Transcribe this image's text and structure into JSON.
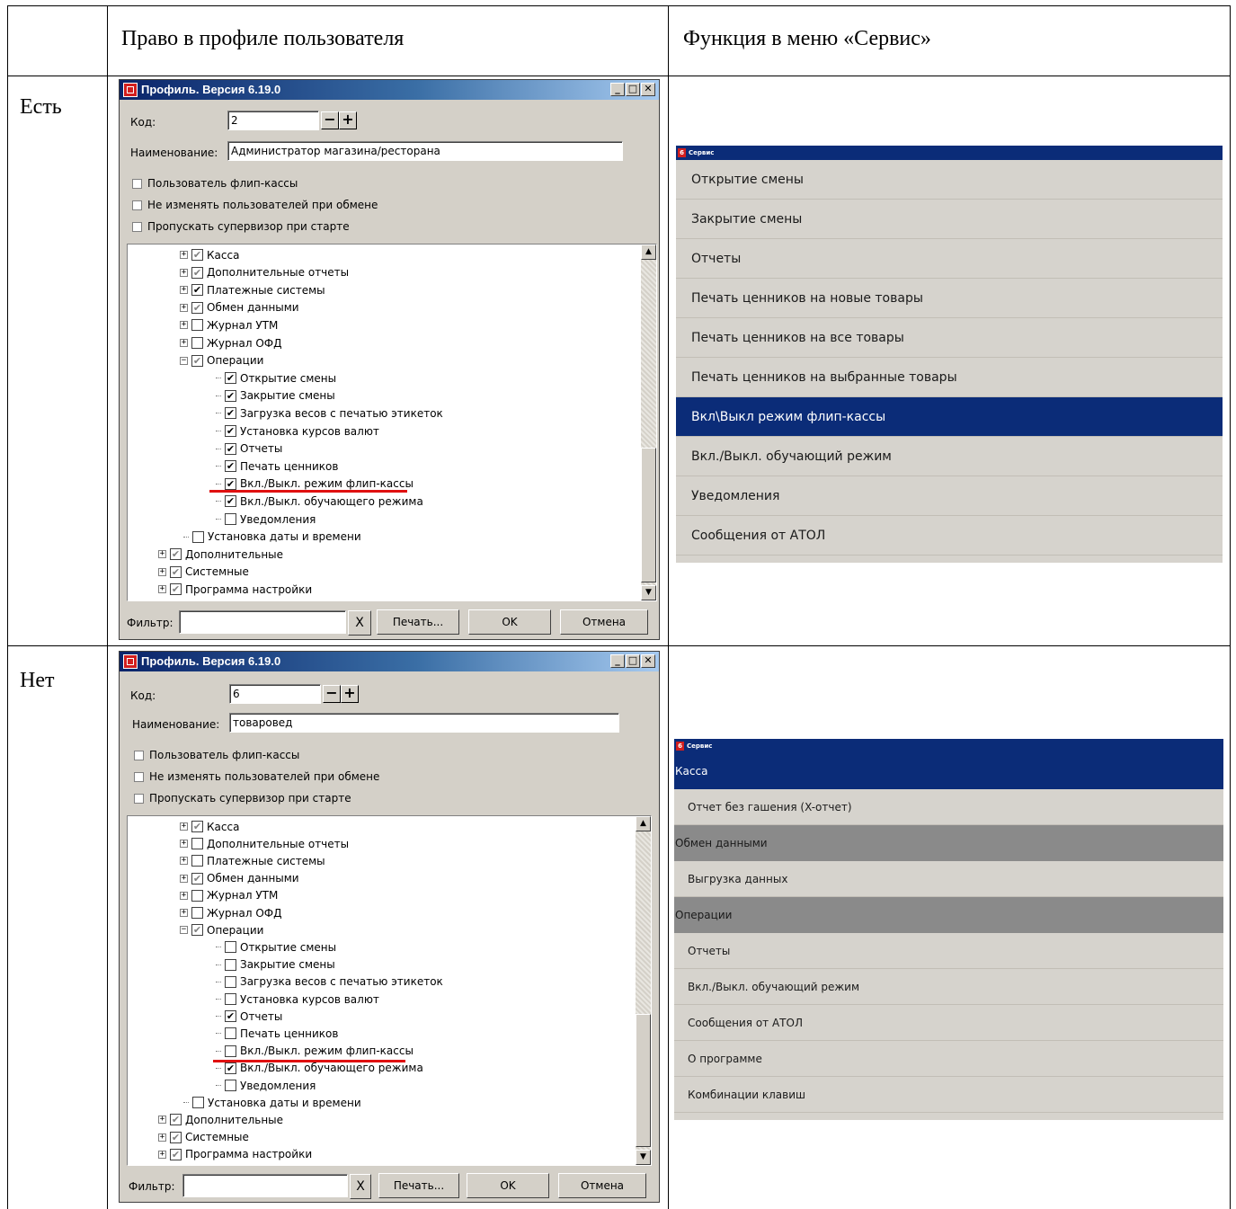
{
  "table": {
    "col1_header": "Право в профиле пользователя",
    "col2_header": "Функция в меню «Сервис»",
    "row1_label": "Есть",
    "row2_label": "Нет"
  },
  "dialog1": {
    "title": "Профиль. Версия 6.19.0",
    "code_label": "Код:",
    "code_value": "2",
    "name_label": "Наименование:",
    "name_value": "Администратор магазина/ресторана",
    "opt1": "Пользователь флип-кассы",
    "opt2": "Не изменять пользователей при обмене",
    "opt3": "Пропускать супервизор при старте",
    "tree": [
      {
        "label": "Касса",
        "check": "grey",
        "exp": "+",
        "lvl": 1
      },
      {
        "label": "Дополнительные отчеты",
        "check": "grey",
        "exp": "+",
        "lvl": 1
      },
      {
        "label": "Платежные системы",
        "check": "on",
        "exp": "+",
        "lvl": 1
      },
      {
        "label": "Обмен данными",
        "check": "grey",
        "exp": "+",
        "lvl": 1
      },
      {
        "label": "Журнал УТМ",
        "check": "off",
        "exp": "+",
        "lvl": 1
      },
      {
        "label": "Журнал ОФД",
        "check": "off",
        "exp": "+",
        "lvl": 1
      },
      {
        "label": "Операции",
        "check": "grey",
        "exp": "-",
        "lvl": 1
      },
      {
        "label": "Открытие смены",
        "check": "on",
        "exp": "",
        "lvl": 2
      },
      {
        "label": "Закрытие смены",
        "check": "on",
        "exp": "",
        "lvl": 2
      },
      {
        "label": "Загрузка весов с печатью этикеток",
        "check": "on",
        "exp": "",
        "lvl": 2
      },
      {
        "label": "Установка курсов валют",
        "check": "on",
        "exp": "",
        "lvl": 2
      },
      {
        "label": "Отчеты",
        "check": "on",
        "exp": "",
        "lvl": 2
      },
      {
        "label": "Печать ценников",
        "check": "on",
        "exp": "",
        "lvl": 2
      },
      {
        "label": "Вкл./Выкл. режим флип-кассы",
        "check": "on",
        "exp": "",
        "lvl": 2
      },
      {
        "label": "Вкл./Выкл. обучающего режима",
        "check": "on",
        "exp": "",
        "lvl": 2
      },
      {
        "label": "Уведомления",
        "check": "off",
        "exp": "",
        "lvl": 2
      },
      {
        "label": "Установка даты и времени",
        "check": "off",
        "exp": "",
        "lvl": 1.5
      },
      {
        "label": "Дополнительные",
        "check": "grey",
        "exp": "+",
        "lvl": 0
      },
      {
        "label": "Системные",
        "check": "grey",
        "exp": "+",
        "lvl": 0
      },
      {
        "label": "Программа настройки",
        "check": "grey",
        "exp": "+",
        "lvl": 0
      }
    ],
    "filter_label": "Фильтр:",
    "filter_value": "",
    "clear_glyph": "X",
    "print_btn": "Печать...",
    "ok_btn": "OK",
    "cancel_btn": "Отмена"
  },
  "dialog2": {
    "title": "Профиль. Версия 6.19.0",
    "code_label": "Код:",
    "code_value": "6",
    "name_label": "Наименование:",
    "name_value": "товаровед",
    "opt1": "Пользователь флип-кассы",
    "opt2": "Не изменять пользователей при обмене",
    "opt3": "Пропускать супервизор при старте",
    "tree": [
      {
        "label": "Касса",
        "check": "grey",
        "exp": "+",
        "lvl": 1
      },
      {
        "label": "Дополнительные отчеты",
        "check": "off",
        "exp": "+",
        "lvl": 1
      },
      {
        "label": "Платежные системы",
        "check": "off",
        "exp": "+",
        "lvl": 1
      },
      {
        "label": "Обмен данными",
        "check": "grey",
        "exp": "+",
        "lvl": 1
      },
      {
        "label": "Журнал УТМ",
        "check": "off",
        "exp": "+",
        "lvl": 1
      },
      {
        "label": "Журнал ОФД",
        "check": "off",
        "exp": "+",
        "lvl": 1
      },
      {
        "label": "Операции",
        "check": "grey",
        "exp": "-",
        "lvl": 1
      },
      {
        "label": "Открытие смены",
        "check": "off",
        "exp": "",
        "lvl": 2
      },
      {
        "label": "Закрытие смены",
        "check": "off",
        "exp": "",
        "lvl": 2
      },
      {
        "label": "Загрузка весов с печатью этикеток",
        "check": "off",
        "exp": "",
        "lvl": 2
      },
      {
        "label": "Установка курсов валют",
        "check": "off",
        "exp": "",
        "lvl": 2
      },
      {
        "label": "Отчеты",
        "check": "on",
        "exp": "",
        "lvl": 2
      },
      {
        "label": "Печать ценников",
        "check": "off",
        "exp": "",
        "lvl": 2
      },
      {
        "label": "Вкл./Выкл. режим флип-кассы",
        "check": "off",
        "exp": "",
        "lvl": 2
      },
      {
        "label": "Вкл./Выкл. обучающего режима",
        "check": "on",
        "exp": "",
        "lvl": 2
      },
      {
        "label": "Уведомления",
        "check": "off",
        "exp": "",
        "lvl": 2
      },
      {
        "label": "Установка даты и времени",
        "check": "off",
        "exp": "",
        "lvl": 1.5
      },
      {
        "label": "Дополнительные",
        "check": "grey",
        "exp": "+",
        "lvl": 0
      },
      {
        "label": "Системные",
        "check": "grey",
        "exp": "+",
        "lvl": 0
      },
      {
        "label": "Программа настройки",
        "check": "grey",
        "exp": "+",
        "lvl": 0
      }
    ],
    "filter_label": "Фильтр:",
    "filter_value": "",
    "clear_glyph": "X",
    "print_btn": "Печать...",
    "ok_btn": "OK",
    "cancel_btn": "Отмена"
  },
  "service1": {
    "icon_text": "6",
    "title": "Сервис",
    "items": [
      {
        "label": "Открытие смены",
        "selected": false
      },
      {
        "label": "Закрытие смены",
        "selected": false
      },
      {
        "label": "Отчеты",
        "selected": false
      },
      {
        "label": "Печать ценников на новые товары",
        "selected": false
      },
      {
        "label": "Печать ценников на все товары",
        "selected": false
      },
      {
        "label": "Печать ценников на выбранные товары",
        "selected": false
      },
      {
        "label": "Вкл\\Выкл режим флип-кассы",
        "selected": true
      },
      {
        "label": "Вкл./Выкл. обучающий режим",
        "selected": false
      },
      {
        "label": "Уведомления",
        "selected": false
      },
      {
        "label": "Сообщения от АТОЛ",
        "selected": false
      }
    ]
  },
  "service2": {
    "icon_text": "6",
    "title": "Сервис",
    "items": [
      {
        "label": "Касса",
        "kind": "group-selected"
      },
      {
        "label": "Отчет без гашения (X-отчет)",
        "kind": "item"
      },
      {
        "label": "Обмен данными",
        "kind": "group"
      },
      {
        "label": "Выгрузка данных",
        "kind": "item"
      },
      {
        "label": "Операции",
        "kind": "group"
      },
      {
        "label": "Отчеты",
        "kind": "item"
      },
      {
        "label": "Вкл./Выкл. обучающий режим",
        "kind": "item"
      },
      {
        "label": "Сообщения от АТОЛ",
        "kind": "item"
      },
      {
        "label": "О программе",
        "kind": "item"
      },
      {
        "label": "Комбинации клавиш",
        "kind": "item"
      }
    ]
  },
  "colors": {
    "selection_blue": "#0b2c78",
    "group_grey": "#8a8a8a",
    "underline_red": "#e01010"
  }
}
